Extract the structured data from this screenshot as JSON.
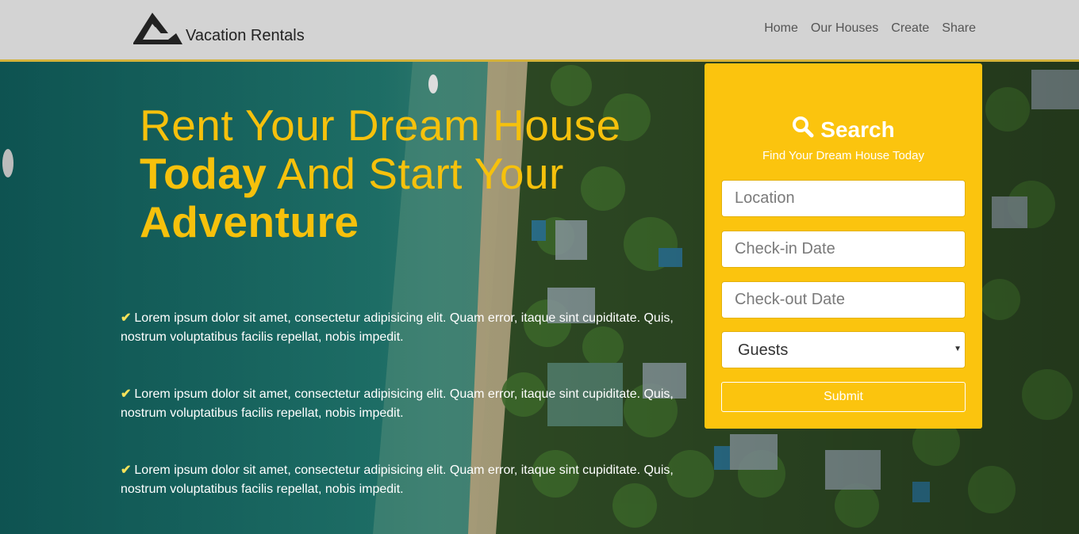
{
  "brand": {
    "name": "Vacation Rentals",
    "logo_icon": "mountain-logo-icon"
  },
  "nav": {
    "items": [
      {
        "label": "Home"
      },
      {
        "label": "Our Houses"
      },
      {
        "label": "Create"
      },
      {
        "label": "Share"
      }
    ]
  },
  "hero": {
    "headline": {
      "line1": "Rent Your Dream House",
      "line2_bold": "Today",
      "line2_rest": " And Start Your",
      "line3": "Adventure"
    },
    "features": [
      {
        "icon": "check-icon",
        "text": "Lorem ipsum dolor sit amet, consectetur adipisicing elit. Quam error, itaque sint cupiditate. Quis, nostrum voluptatibus facilis repellat, nobis impedit."
      },
      {
        "icon": "check-icon",
        "text": "Lorem ipsum dolor sit amet, consectetur adipisicing elit. Quam error, itaque sint cupiditate. Quis, nostrum voluptatibus facilis repellat, nobis impedit."
      },
      {
        "icon": "check-icon",
        "text": "Lorem ipsum dolor sit amet, consectetur adipisicing elit. Quam error, itaque sint cupiditate. Quis, nostrum voluptatibus facilis repellat, nobis impedit."
      }
    ]
  },
  "search": {
    "icon": "search-icon",
    "title": "Search",
    "subtitle": "Find Your Dream House Today",
    "location_placeholder": "Location",
    "checkin_placeholder": "Check-in Date",
    "checkout_placeholder": "Check-out Date",
    "guests_selected": "Guests",
    "submit_label": "Submit"
  },
  "colors": {
    "accent": "#fbc40e",
    "headline": "#f6c10c",
    "navbar_bg": "#d3d3d3",
    "navbar_border": "#d4b23a"
  }
}
